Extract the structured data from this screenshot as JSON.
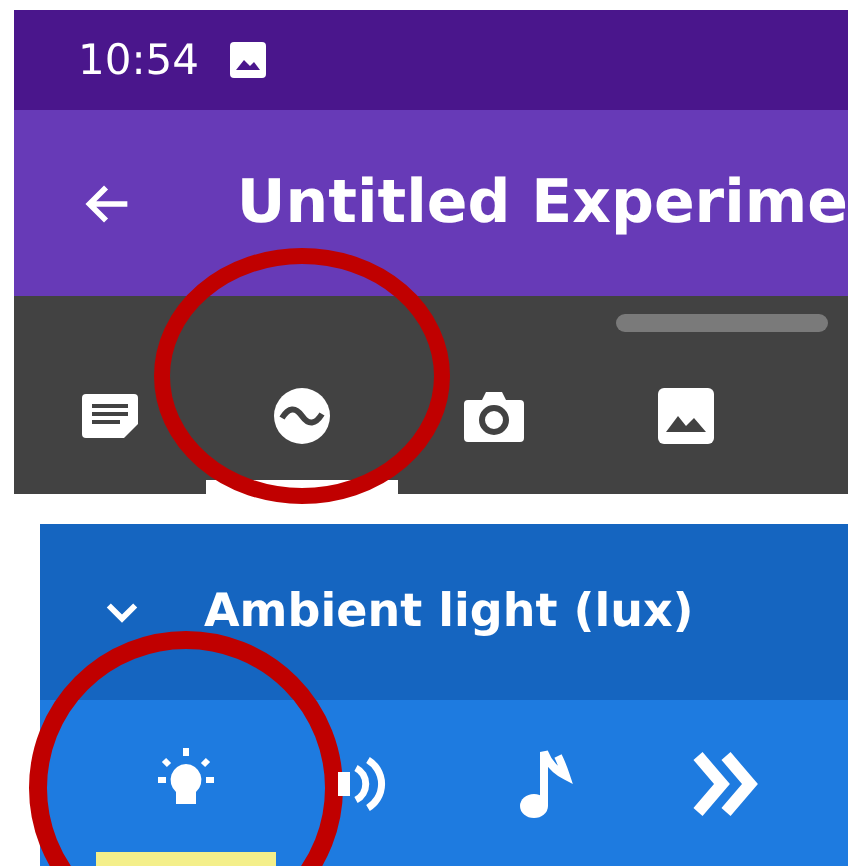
{
  "status_bar": {
    "time": "10:54"
  },
  "app_bar": {
    "title": "Untitled Experime"
  },
  "tool_tabs": [
    {
      "kind": "notes",
      "selected": false,
      "highlighted": false
    },
    {
      "kind": "sensor",
      "selected": true,
      "highlighted": true
    },
    {
      "kind": "camera",
      "selected": false,
      "highlighted": false
    },
    {
      "kind": "gallery",
      "selected": false,
      "highlighted": false
    }
  ],
  "sensor_card": {
    "title": "Ambient light (lux)",
    "expanded": true,
    "sensors": [
      {
        "kind": "light",
        "selected": true,
        "highlighted": true
      },
      {
        "kind": "sound",
        "selected": false,
        "highlighted": false
      },
      {
        "kind": "pitch",
        "selected": false,
        "highlighted": false
      },
      {
        "kind": "speed",
        "selected": false,
        "highlighted": false
      }
    ]
  }
}
